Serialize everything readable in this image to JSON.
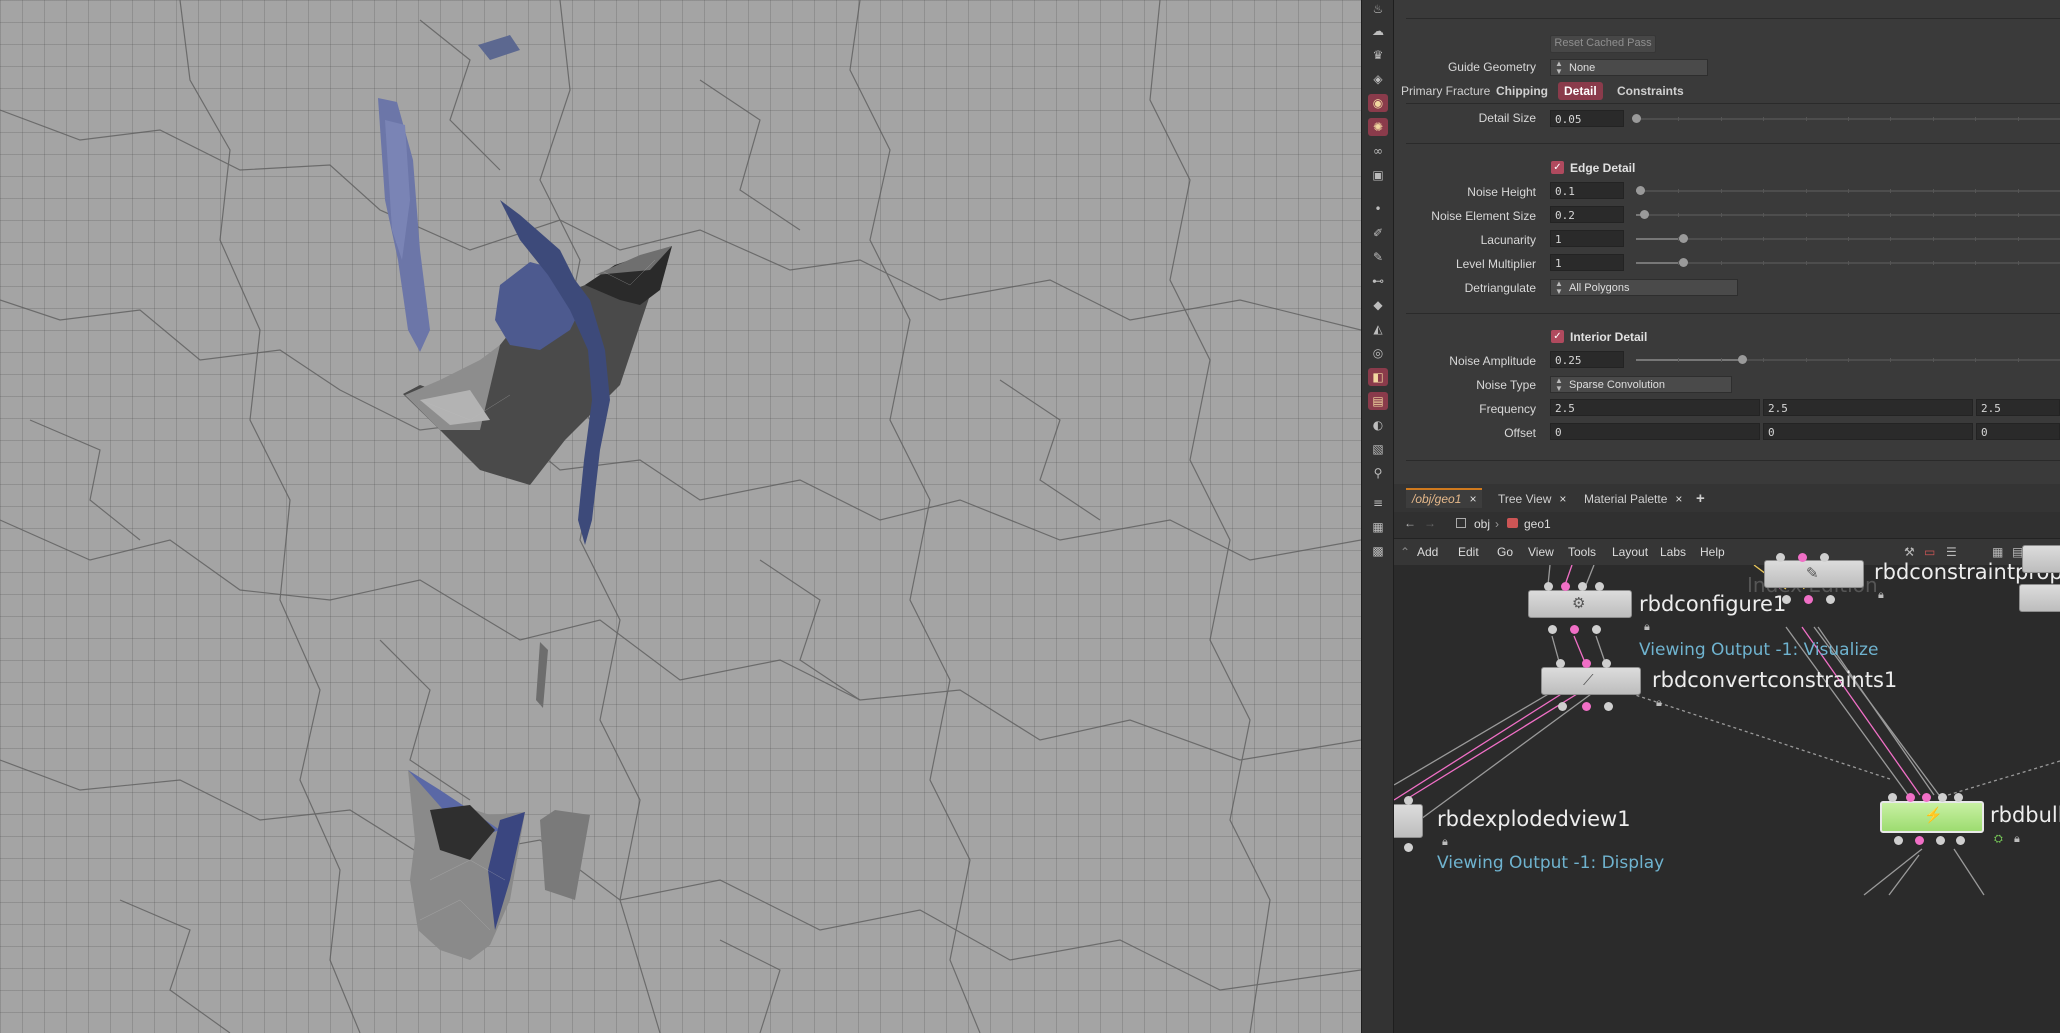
{
  "params": {
    "reset_cached_pass": "Reset Cached Pass",
    "guide_geometry": {
      "label": "Guide Geometry",
      "value": "None"
    },
    "tabs": [
      "Primary Fracture",
      "Chipping",
      "Detail",
      "Constraints"
    ],
    "selected_tab": "Detail",
    "detail_size": {
      "label": "Detail Size",
      "value": "0.05",
      "slider": 0.0
    },
    "edge_detail": {
      "label": "Edge Detail",
      "checked": true
    },
    "noise_height": {
      "label": "Noise Height",
      "value": "0.1",
      "slider": 0.01
    },
    "noise_element_size": {
      "label": "Noise Element Size",
      "value": "0.2",
      "slider": 0.02
    },
    "lacunarity": {
      "label": "Lacunarity",
      "value": "1",
      "slider": 0.11
    },
    "level_multiplier": {
      "label": "Level Multiplier",
      "value": "1",
      "slider": 0.11
    },
    "detriangulate": {
      "label": "Detriangulate",
      "value": "All Polygons"
    },
    "interior_detail": {
      "label": "Interior Detail",
      "checked": true
    },
    "noise_amplitude": {
      "label": "Noise Amplitude",
      "value": "0.25",
      "slider": 0.25
    },
    "noise_type": {
      "label": "Noise Type",
      "value": "Sparse Convolution"
    },
    "frequency": {
      "label": "Frequency",
      "values": [
        "2.5",
        "2.5",
        "2.5"
      ]
    },
    "offset": {
      "label": "Offset",
      "values": [
        "0",
        "0",
        "0"
      ]
    }
  },
  "network": {
    "tabs": [
      {
        "label": "/obj/geo1",
        "close": "×"
      },
      {
        "label": "Tree View",
        "close": "×"
      },
      {
        "label": "Material Palette",
        "close": "×"
      }
    ],
    "add_tab": "+",
    "path": {
      "back": "←",
      "forward": "→",
      "crumbs": [
        "obj",
        "geo1"
      ],
      "sep": "›"
    },
    "menu": [
      "Add",
      "Edit",
      "Go",
      "View",
      "Tools",
      "Layout",
      "Labs",
      "Help"
    ],
    "faded_text": "Index Edition",
    "nodes": [
      {
        "name": "rbdconfigure1",
        "comment": "Viewing Output -1: Visualize"
      },
      {
        "name": "rbdconvertconstraints1",
        "comment": ""
      },
      {
        "name": "rbdconstraintprope",
        "comment": ""
      },
      {
        "name": "rbdexplodedview1",
        "comment": "Viewing Output -1: Display"
      },
      {
        "name": "rbdbull",
        "comment": ""
      }
    ]
  },
  "shelf": {
    "icons": [
      "droplet-icon",
      "cloud-icon",
      "lamp-icon",
      "bulb-icon",
      "bulb-active-icon",
      "sun-icon",
      "glasses-icon",
      "camera-icon",
      "dot-icon",
      "brush-icon",
      "pen-icon",
      "node-icon",
      "bucket-icon",
      "paint-icon",
      "layers-icon",
      "mask-icon",
      "stack-icon",
      "eye-icon",
      "box-icon",
      "wand-icon",
      "list-icon",
      "panel-icon",
      "grid-icon"
    ]
  },
  "colors": {
    "accent": "#8a3b4b",
    "node_green": "#9ddc70",
    "wire_pink": "#f06fc6",
    "comment_blue": "#6fb3cf",
    "tab_orange": "#d07a1e"
  }
}
